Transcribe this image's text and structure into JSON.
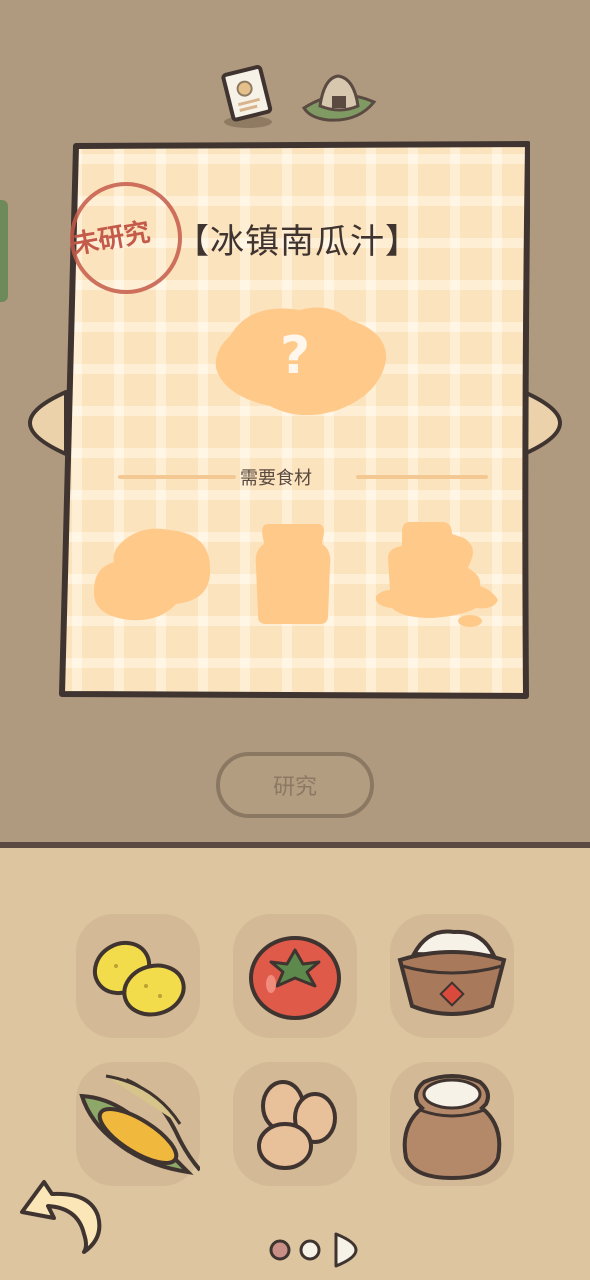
{
  "recipe": {
    "status_stamp": "未研究",
    "title": "【冰镇南瓜汁】",
    "mystery_mark": "?",
    "ingredients_label": "需要食材"
  },
  "actions": {
    "research_label": "研究"
  },
  "tabs_top": [
    "note-icon",
    "onigiri-icon"
  ],
  "ingredients": [
    {
      "icon": "lemon-icon"
    },
    {
      "icon": "tomato-icon"
    },
    {
      "icon": "rice-bowl-icon"
    },
    {
      "icon": "corn-icon"
    },
    {
      "icon": "eggs-icon"
    },
    {
      "icon": "flour-sack-icon"
    }
  ],
  "pagination": {
    "current": 1,
    "total": 3
  },
  "colors": {
    "background_top": "#b09a7f",
    "background_bottom": "#dcc59f",
    "card": "#fbe3bd",
    "silhouette": "#ffc98a",
    "stamp": "#c45a4a"
  }
}
